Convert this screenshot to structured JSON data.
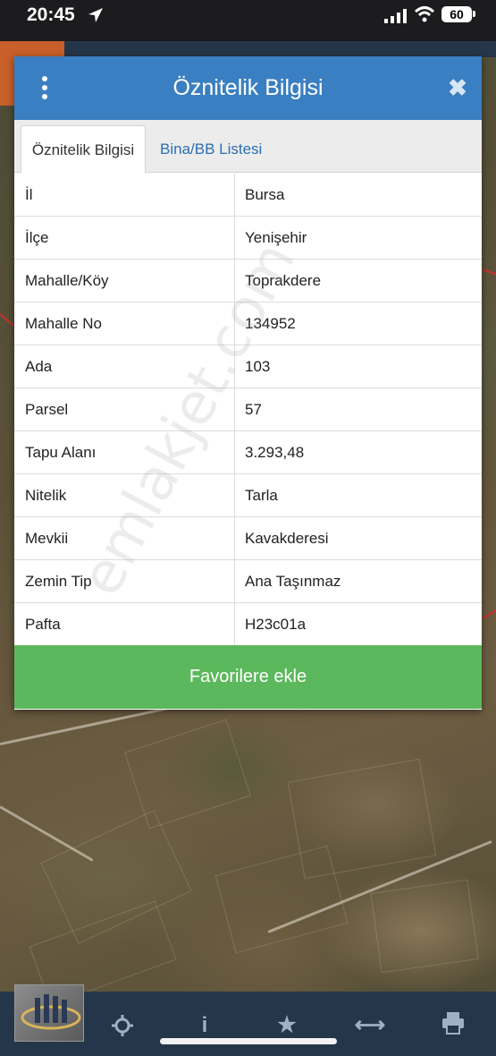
{
  "status_bar": {
    "time": "20:45",
    "battery": "60"
  },
  "dialog": {
    "title": "Öznitelik Bilgisi",
    "tabs": [
      {
        "label": "Öznitelik Bilgisi",
        "active": true
      },
      {
        "label": "Bina/BB Listesi",
        "active": false
      }
    ],
    "rows": [
      {
        "key": "İl",
        "value": "Bursa"
      },
      {
        "key": "İlçe",
        "value": "Yenişehir"
      },
      {
        "key": "Mahalle/Köy",
        "value": "Toprakdere"
      },
      {
        "key": "Mahalle No",
        "value": "134952"
      },
      {
        "key": "Ada",
        "value": "103"
      },
      {
        "key": "Parsel",
        "value": "57"
      },
      {
        "key": "Tapu Alanı",
        "value": "3.293,48"
      },
      {
        "key": "Nitelik",
        "value": "Tarla"
      },
      {
        "key": "Mevkii",
        "value": "Kavakderesi"
      },
      {
        "key": "Zemin Tip",
        "value": "Ana Taşınmaz"
      },
      {
        "key": "Pafta",
        "value": "H23c01a"
      }
    ],
    "favorite_button": "Favorilere ekle",
    "watermark": "emlakjet.com"
  },
  "toolbar": {
    "icons": [
      "layers-icon",
      "crosshair-icon",
      "info-icon",
      "star-icon",
      "measure-icon",
      "print-icon"
    ]
  },
  "colors": {
    "header_blue": "#3a7fc1",
    "button_green": "#5cb85c",
    "toolbar_navy": "#26364a"
  }
}
